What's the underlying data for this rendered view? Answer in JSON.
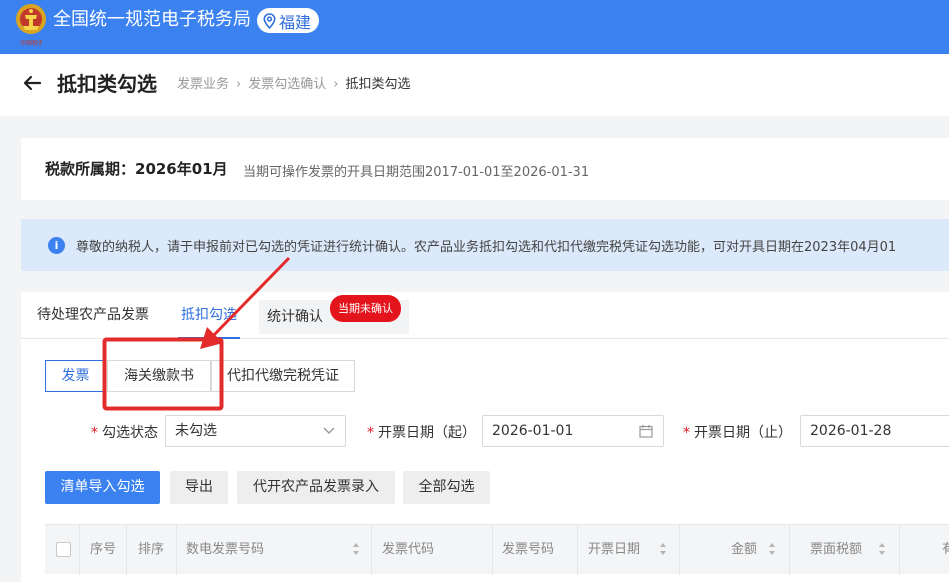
{
  "topbar": {
    "logo_name": "tax-emblem-icon",
    "logo_text": "中国税务",
    "title": "全国统一规范电子税务局",
    "region": "福建",
    "region_icon": "location-pin-icon"
  },
  "header": {
    "back_icon": "arrow-left-icon",
    "title": "抵扣类勾选",
    "breadcrumb": [
      "发票业务",
      "发票勾选确认",
      "抵扣类勾选"
    ]
  },
  "period": {
    "label": "税款所属期：2026年01月",
    "hint": "当期可操作发票的开具日期范围2017-01-01至2026-01-31"
  },
  "notice": {
    "icon": "info-icon",
    "text": "尊敬的纳税人，请于申报前对已勾选的凭证进行统计确认。农产品业务抵扣勾选和代扣代缴完税凭证勾选功能，可对开具日期在2023年04月01"
  },
  "tabs": {
    "items": [
      "待处理农产品发票",
      "抵扣勾选",
      "统计确认"
    ],
    "active_index": 1,
    "badge": "当期未确认"
  },
  "subtabs": {
    "items": [
      "发票",
      "海关缴款书",
      "代扣代缴完税凭证"
    ],
    "active_index": 0
  },
  "filters": {
    "status_label": "勾选状态",
    "status_value": "未勾选",
    "date_start_label": "开票日期（起）",
    "date_start_value": "2026-01-01",
    "date_end_label": "开票日期（止）",
    "date_end_value": "2026-01-28"
  },
  "actions": {
    "import_select": "清单导入勾选",
    "export": "导出",
    "agricultural_entry": "代开农产品发票录入",
    "select_all": "全部勾选"
  },
  "table": {
    "columns": [
      "序号",
      "排序",
      "数电发票号码",
      "发票代码",
      "发票号码",
      "开票日期",
      "金额",
      "票面税额",
      "有"
    ]
  },
  "colors": {
    "brand_blue": "#3b82f0",
    "active_blue": "#2f6fde",
    "notice_bg": "#dbe9fb",
    "badge_red": "#e3141c",
    "annotation_red": "#e32b2b"
  }
}
